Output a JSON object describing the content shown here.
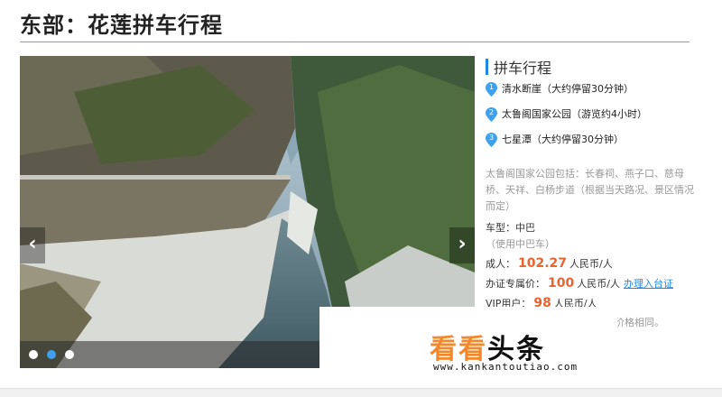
{
  "header": {
    "title": "东部：花莲拼车行程"
  },
  "carousel": {
    "prev_glyph": "‹",
    "next_glyph": "›",
    "dot_count": 3,
    "active_dot": 2
  },
  "itinerary": {
    "title": "拼车行程",
    "stops": [
      {
        "number": "1",
        "text": "清水断崖（大约停留30分钟）"
      },
      {
        "number": "2",
        "text": "太鲁阁国家公园（游览约4小时）"
      },
      {
        "number": "3",
        "text": "七星潭（大约停留30分钟）"
      }
    ],
    "description": "太鲁阁国家公园包括：长春祠、燕子口、慈母桥、天祥、白杨步道（根据当天路况、景区情况而定）",
    "vehicle_label": "车型：中巴",
    "vehicle_note": "（使用中巴车）",
    "adult_label": "成人：",
    "adult_price": "102.27",
    "adult_unit": "人民币/人",
    "permit_label": "办证专属价：",
    "permit_price": "100",
    "permit_unit": "人民币/人",
    "permit_link": "办理入台证",
    "vip_label": "VIP用户：",
    "vip_price": "98",
    "vip_unit": "人民币/人",
    "footnote": "成人、儿童（含不占座儿童）价格相同。"
  },
  "watermark": {
    "part1": "看看",
    "part2": "头条",
    "url": "www.kankantoutiao.com"
  },
  "colors": {
    "accent": "#1e88e5",
    "price": "#e8632e",
    "watermark_orange": "#f2882b"
  }
}
